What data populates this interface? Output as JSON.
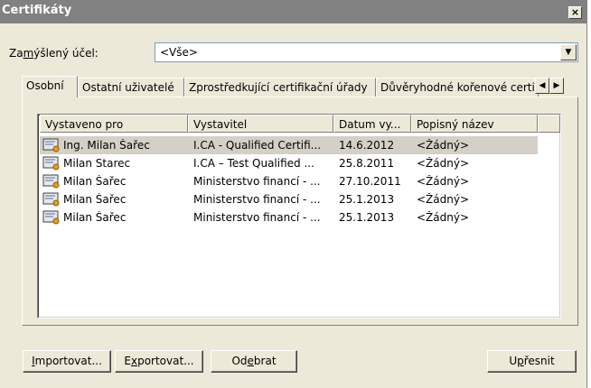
{
  "window": {
    "title": "Certifikáty",
    "close": "×"
  },
  "purpose": {
    "label_pre": "Za",
    "label_accel": "m",
    "label_post": "ýšlený účel:",
    "value": "<Vše>"
  },
  "tabs": [
    "Osobní",
    "Ostatní uživatelé",
    "Zprostředkující certifikační úřady",
    "Důvěryhodné kořenové certifikační úřady"
  ],
  "columns": [
    "Vystaveno pro",
    "Vystavitel",
    "Datum vy...",
    "Popisný název"
  ],
  "rows": [
    {
      "issued_to": "Ing. Milan Šařec",
      "issuer": "I.CA - Qualified Certifi...",
      "date": "14.6.2012",
      "friendly": "<Žádný>"
    },
    {
      "issued_to": "Milan Starec",
      "issuer": "I.CA – Test Qualified ...",
      "date": "25.8.2011",
      "friendly": "<Žádný>"
    },
    {
      "issued_to": "Milan Šařec",
      "issuer": "Ministerstvo financí - ...",
      "date": "27.10.2011",
      "friendly": "<Žádný>"
    },
    {
      "issued_to": "Milan Šařec",
      "issuer": "Ministerstvo financí - ...",
      "date": "25.1.2013",
      "friendly": "<Žádný>"
    },
    {
      "issued_to": "Milan Šařec",
      "issuer": "Ministerstvo financí - ...",
      "date": "25.1.2013",
      "friendly": "<Žádný>"
    }
  ],
  "buttons": {
    "import": {
      "accel": "I",
      "rest": "mportovat..."
    },
    "export": {
      "pre": "E",
      "accel": "x",
      "rest": "portovat..."
    },
    "remove": {
      "pre": "Od",
      "accel": "e",
      "rest": "brat"
    },
    "advanced": {
      "pre": "U",
      "accel": "p",
      "rest": "řesnit"
    }
  },
  "icons": {
    "close": "close-icon",
    "dropdown": "chevron-down-icon",
    "tab_left": "chevron-left-icon",
    "tab_right": "chevron-right-icon",
    "certificate": "certificate-icon"
  }
}
